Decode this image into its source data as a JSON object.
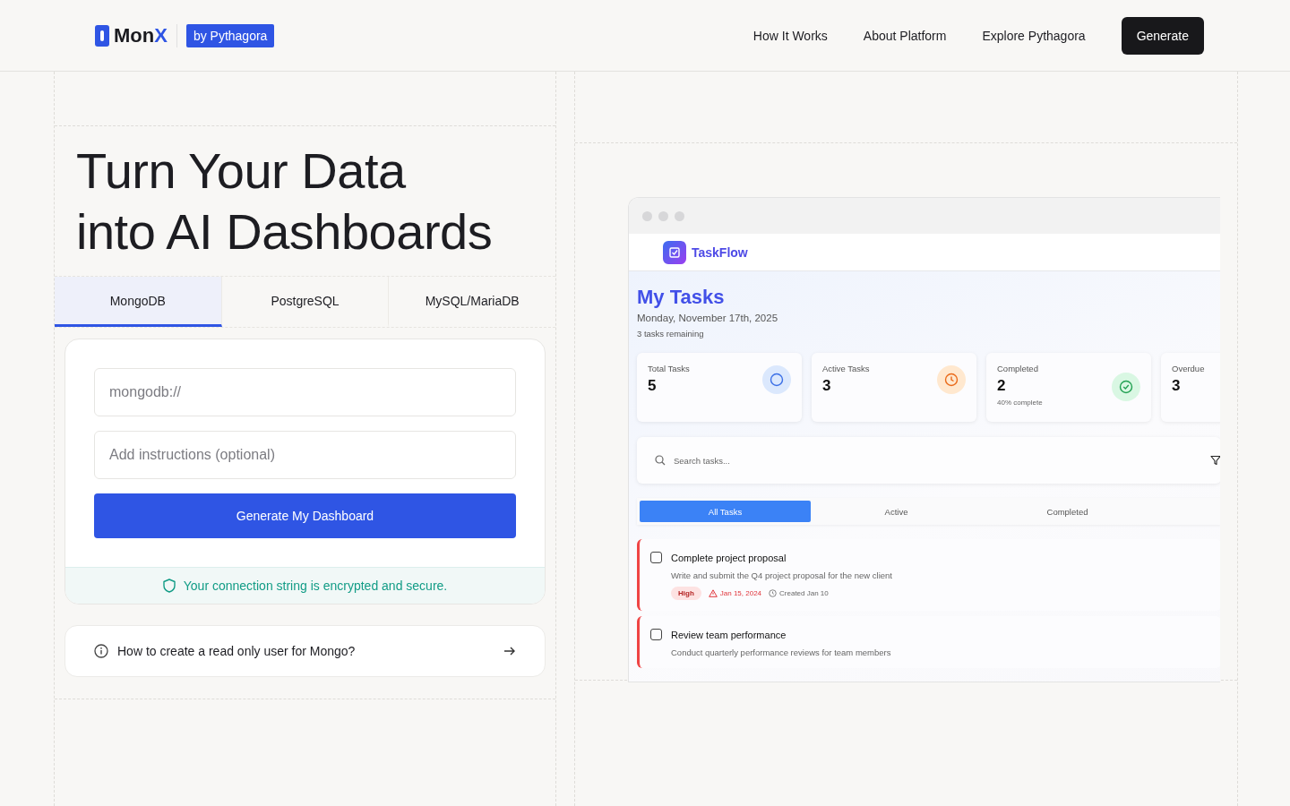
{
  "header": {
    "logo_main": "Mon",
    "logo_accent": "X",
    "badge": "by Pythagora",
    "nav": [
      "How It Works",
      "About Platform",
      "Explore Pythagora"
    ],
    "cta": "Generate"
  },
  "hero": {
    "title_lines": [
      "Turn Your Data",
      "into AI Dashboards"
    ]
  },
  "db_tabs": [
    {
      "label": "MongoDB",
      "selected": true
    },
    {
      "label": "PostgreSQL",
      "selected": false
    },
    {
      "label": "MySQL/MariaDB",
      "selected": false
    }
  ],
  "form": {
    "connection": {
      "placeholder": "mongodb://"
    },
    "instructions": {
      "placeholder": "Add instructions (optional)"
    },
    "submit": "Generate My Dashboard",
    "security_note": "Your connection string is encrypted and secure."
  },
  "help_link": "How to create a read only user for Mongo?",
  "preview": {
    "app_name": "TaskFlow",
    "title": "My Tasks",
    "date": "Monday, November 17th, 2025",
    "remaining": "3 tasks remaining",
    "stats": [
      {
        "label": "Total Tasks",
        "value": "5",
        "kind": "circle"
      },
      {
        "label": "Active Tasks",
        "value": "3",
        "kind": "clock"
      },
      {
        "label": "Completed",
        "value": "2",
        "note": "40% complete",
        "kind": "check"
      },
      {
        "label": "Overdue",
        "value": "3",
        "kind": "none"
      }
    ],
    "search": {
      "placeholder": "Search tasks..."
    },
    "tabs": [
      {
        "label": "All Tasks",
        "selected": true
      },
      {
        "label": "Active",
        "selected": false
      },
      {
        "label": "Completed",
        "selected": false
      }
    ],
    "tasks": [
      {
        "title": "Complete project proposal",
        "description": "Write and submit the Q4 project proposal for the new client",
        "checked": false,
        "priority": "High",
        "due": "Jan 15, 2024",
        "created": "Created Jan 10"
      },
      {
        "title": "Review team performance",
        "description": "Conduct quarterly performance reviews for team members",
        "checked": false
      }
    ]
  }
}
